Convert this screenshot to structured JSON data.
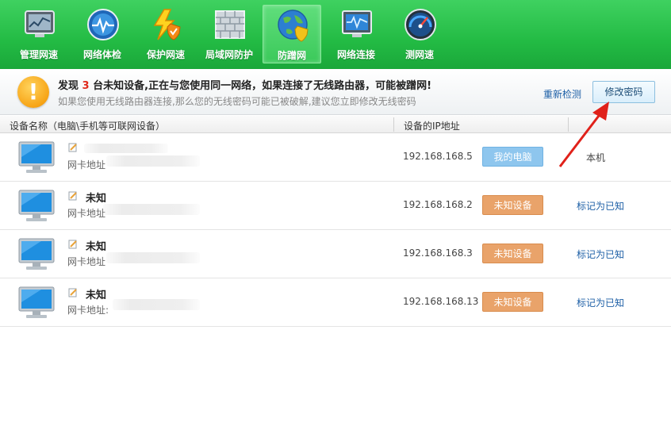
{
  "toolbar": {
    "items": [
      {
        "label": "管理网速",
        "icon": "speed-monitor-icon"
      },
      {
        "label": "网络体检",
        "icon": "heartbeat-globe-icon"
      },
      {
        "label": "保护网速",
        "icon": "lightning-shield-icon"
      },
      {
        "label": "局域网防护",
        "icon": "firewall-brick-icon"
      },
      {
        "label": "防蹭网",
        "icon": "globe-shield-icon",
        "active": true
      },
      {
        "label": "网络连接",
        "icon": "network-screen-icon"
      },
      {
        "label": "测网速",
        "icon": "speedometer-icon"
      }
    ]
  },
  "warning": {
    "icon": "exclamation-icon",
    "prefix": "发现",
    "count": "3",
    "suffix": "台未知设备,正在与您使用同一网络，如果连接了无线路由器，可能被蹭网!",
    "detail": "如果您使用无线路由器连接,那么您的无线密码可能已被破解,建议您立即修改无线密码",
    "recheck_label": "重新检测",
    "change_password_label": "修改密码"
  },
  "table": {
    "headers": {
      "device_name": "设备名称（电脑\\手机等可联网设备）",
      "ip": "设备的IP地址"
    },
    "rows": [
      {
        "name": "",
        "mac_label": "网卡地址",
        "ip": "192.168.168.5",
        "status": "我的电脑",
        "status_type": "mine",
        "action": "本机",
        "action_link": false
      },
      {
        "name": "未知",
        "mac_label": "网卡地址",
        "ip": "192.168.168.2",
        "status": "未知设备",
        "status_type": "unknown",
        "action": "标记为已知",
        "action_link": true
      },
      {
        "name": "未知",
        "mac_label": "网卡地址",
        "ip": "192.168.168.3",
        "status": "未知设备",
        "status_type": "unknown",
        "action": "标记为已知",
        "action_link": true
      },
      {
        "name": "未知",
        "mac_label": "网卡地址:",
        "ip": "192.168.168.13",
        "status": "未知设备",
        "status_type": "unknown",
        "action": "标记为已知",
        "action_link": true
      }
    ]
  },
  "colors": {
    "toolbar_green": "#23bb44",
    "warning_count_red": "#e02a1d",
    "badge_mine_blue": "#8ec6ee",
    "badge_unknown_orange": "#e9a36a",
    "link_blue": "#1d5fa6",
    "annotation_arrow_red": "#e0211a"
  }
}
